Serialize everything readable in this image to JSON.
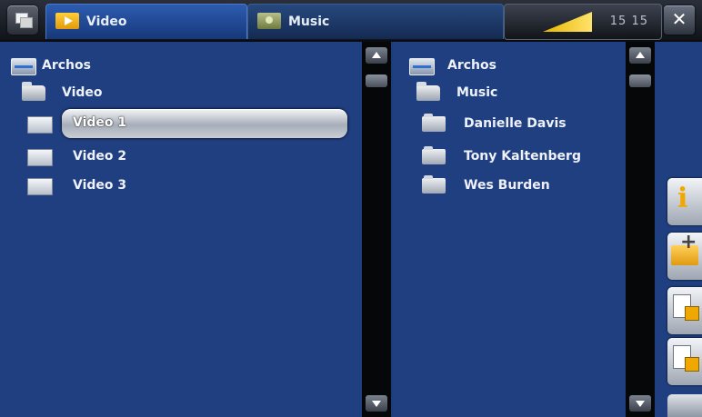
{
  "topbar": {
    "tabs": [
      {
        "label": "Video",
        "icon": "video-folder-icon",
        "active": true
      },
      {
        "label": "Music",
        "icon": "music-folder-icon",
        "active": false
      }
    ],
    "clock": "15 15",
    "menu_icon": "menu-icon",
    "close_icon": "close-icon",
    "volume_icon": "volume-icon"
  },
  "left_pane": {
    "root": {
      "label": "Archos",
      "icon": "drive-icon"
    },
    "folder": {
      "label": "Video",
      "icon": "open-folder-icon"
    },
    "items": [
      {
        "label": "Video 1",
        "icon": "video-file-icon",
        "selected": true
      },
      {
        "label": "Video 2",
        "icon": "video-file-icon",
        "selected": false
      },
      {
        "label": "Video 3",
        "icon": "video-file-icon",
        "selected": false
      }
    ]
  },
  "right_pane": {
    "root": {
      "label": "Archos",
      "icon": "drive-icon"
    },
    "folder": {
      "label": "Music",
      "icon": "open-folder-icon"
    },
    "items": [
      {
        "label": "Danielle Davis",
        "icon": "folder-icon"
      },
      {
        "label": "Tony Kaltenberg",
        "icon": "folder-icon"
      },
      {
        "label": "Wes Burden",
        "icon": "folder-icon"
      }
    ]
  },
  "actions": [
    {
      "icon": "info-icon"
    },
    {
      "icon": "add-folder-icon"
    },
    {
      "icon": "copy-icon"
    },
    {
      "icon": "move-icon"
    }
  ],
  "colors": {
    "background": "#1f3f80",
    "active_tab": "#2d5cb0",
    "accent": "#f0a800"
  }
}
